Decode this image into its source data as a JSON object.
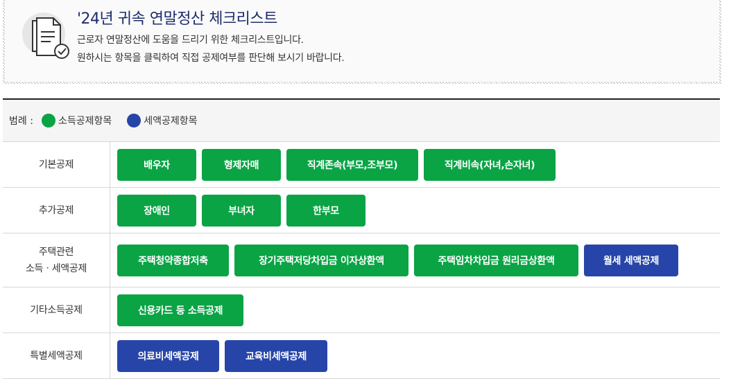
{
  "header": {
    "title": "'24년 귀속 연말정산 체크리스트",
    "desc_line1": "근로자 연말정산에 도움을 드리기 위한 체크리스트입니다.",
    "desc_line2": "원하시는 항목을 클릭하여 직접 공제여부를 판단해 보시기 바랍니다.",
    "icon": "document-check-icon"
  },
  "colors": {
    "green": "#0aa445",
    "blue": "#2745a8",
    "title": "#1d2c6b"
  },
  "legend": {
    "title": "범례 :",
    "income_label": "소득공제항목",
    "tax_label": "세액공제항목"
  },
  "rows": [
    {
      "label": "기본공제",
      "items": [
        {
          "label": "배우자",
          "type": "income"
        },
        {
          "label": "형제자매",
          "type": "income"
        },
        {
          "label": "직계존속(부모,조부모)",
          "type": "income"
        },
        {
          "label": "직계비속(자녀,손자녀)",
          "type": "income"
        }
      ]
    },
    {
      "label": "추가공제",
      "items": [
        {
          "label": "장애인",
          "type": "income"
        },
        {
          "label": "부녀자",
          "type": "income"
        },
        {
          "label": "한부모",
          "type": "income"
        }
      ]
    },
    {
      "label_line1": "주택관련",
      "label_line2": "소득ㆍ세액공제",
      "items": [
        {
          "label": "주택청약종합저축",
          "type": "income"
        },
        {
          "label": "장기주택저당차입금 이자상환액",
          "type": "income"
        },
        {
          "label": "주택임차차입금 원리금상환액",
          "type": "income"
        },
        {
          "label": "월세 세액공제",
          "type": "tax"
        }
      ]
    },
    {
      "label": "기타소득공제",
      "items": [
        {
          "label": "신용카드 등 소득공제",
          "type": "income"
        }
      ]
    },
    {
      "label": "특별세액공제",
      "items": [
        {
          "label": "의료비세액공제",
          "type": "tax"
        },
        {
          "label": "교육비세액공제",
          "type": "tax"
        }
      ]
    }
  ]
}
